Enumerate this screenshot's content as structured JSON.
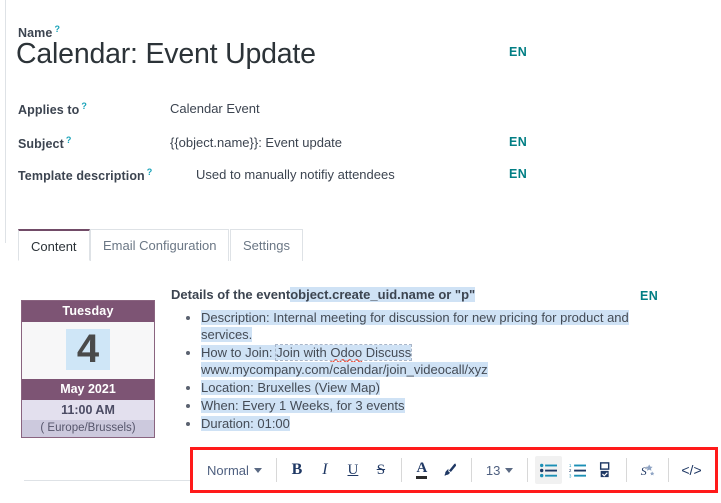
{
  "form": {
    "name": {
      "label": "Name",
      "help": "?",
      "value": "Calendar: Event Update",
      "lang": "EN"
    },
    "applies_to": {
      "label": "Applies to",
      "help": "?",
      "value": "Calendar Event"
    },
    "subject": {
      "label": "Subject",
      "help": "?",
      "value": "{{object.name}}: Event update",
      "lang": "EN"
    },
    "template_description": {
      "label": "Template description",
      "help": "?",
      "value": "Used to manually notifiy attendees",
      "lang": "EN"
    }
  },
  "tabs": [
    {
      "label": "Content",
      "active": true
    },
    {
      "label": "Email Configuration",
      "active": false
    },
    {
      "label": "Settings",
      "active": false
    }
  ],
  "content": {
    "lang": "EN",
    "date_card": {
      "weekday": "Tuesday",
      "day": "4",
      "month_year": "May 2021",
      "time": "11:00 AM",
      "timezone": "( Europe/Brussels)"
    },
    "details_heading_static": "Details of the event",
    "details_heading_placeholder": "object.create_uid.name or \"p\"",
    "bullets": [
      "Description: Internal meeting for discussion for new pricing for product and services.",
      "How to Join: Join with Odoo Discuss www.mycompany.com/calendar/join_videocall/xyz",
      "Location: Bruxelles (View Map)",
      "When: Every 1 Weeks, for 3 events",
      "Duration: 01:00"
    ],
    "bullet_parts": {
      "b1_line1": "Description: Internal meeting for discussion for new pricing for product and",
      "b1_line2": "services.",
      "b2_label": "How to Join: ",
      "b2_link_a": "Join with ",
      "b2_misspelled": "Odoo",
      "b2_link_b": " Discuss",
      "b2_url": "www.mycompany.com/calendar/join_videocall/xyz",
      "b3": "Location: Bruxelles (View Map)",
      "b4": "When: Every 1 Weeks, for 3 events",
      "b5": "Duration: 01:00"
    }
  },
  "toolbar": {
    "highlight_color": "#ff1a1a",
    "style_select": {
      "value": "Normal",
      "icon": "chevron-down-icon"
    },
    "bold": {
      "glyph": "B",
      "title": "Bold"
    },
    "italic": {
      "glyph": "I",
      "title": "Italic"
    },
    "underline": {
      "glyph": "U",
      "title": "Underline"
    },
    "strikethrough": {
      "glyph": "S",
      "title": "Strikethrough"
    },
    "font_color": {
      "glyph": "A",
      "title": "Font Color"
    },
    "background_color": {
      "icon": "paintbrush-icon",
      "title": "Background Color"
    },
    "font_size": {
      "value": "13",
      "icon": "chevron-down-icon"
    },
    "bulleted_list": {
      "icon": "bulleted-list-icon",
      "active": true
    },
    "numbered_list": {
      "icon": "numbered-list-icon",
      "active": false
    },
    "checklist": {
      "icon": "checklist-icon",
      "active": false
    },
    "clear_format": {
      "icon": "clear-format-icon"
    },
    "code_view": {
      "glyph": "</>",
      "icon": "code-icon"
    }
  },
  "colors": {
    "accent_purple": "#714B67",
    "card_purple": "#7d5474",
    "lang_teal": "#017e84",
    "help_blue": "#17a2b8",
    "selection_blue": "#cfe2f5",
    "highlight_red": "#ff1a1a"
  }
}
